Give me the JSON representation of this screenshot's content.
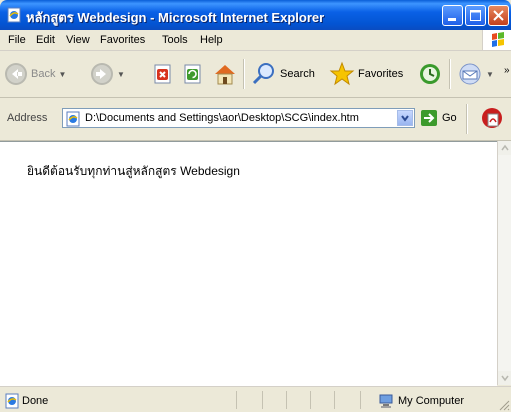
{
  "window": {
    "title": "หลักสูตร Webdesign - Microsoft Internet Explorer"
  },
  "menu": [
    "File",
    "Edit",
    "View",
    "Favorites",
    "Tools",
    "Help"
  ],
  "toolbar": {
    "back_label": "Back",
    "search_label": "Search",
    "favorites_label": "Favorites"
  },
  "address": {
    "label": "Address",
    "value": "D:\\Documents and Settings\\aor\\Desktop\\SCG\\index.htm",
    "go_label": "Go"
  },
  "content": {
    "text": "ยินดีต้อนรับทุกท่านสู่หลักสูตร Webdesign"
  },
  "status": {
    "text": "Done",
    "zone": "My Computer"
  },
  "colors": {
    "titlebar": "#0a61e6",
    "chrome": "#ece9d8"
  }
}
